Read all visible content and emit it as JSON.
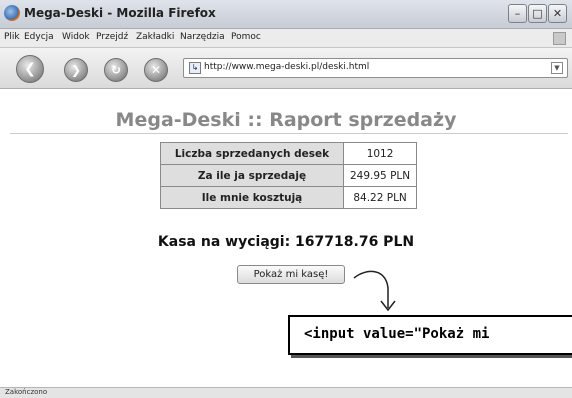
{
  "window": {
    "title": "Mega-Deski - Mozilla Firefox"
  },
  "menu": [
    "Plik",
    "Edycja",
    "Widok",
    "Przejdź",
    "Zakładki",
    "Narzędzia",
    "Pomoc"
  ],
  "url": "http://www.mega-deski.pl/deski.html",
  "page": {
    "title": "Mega-Deski :: Raport sprzedaży",
    "rows": [
      {
        "label": "Liczba sprzedanych desek",
        "value": "1012"
      },
      {
        "label": "Za ile ja sprzedaję",
        "value": "249.95 PLN"
      },
      {
        "label": "Ile mnie kosztują",
        "value": "84.22 PLN"
      }
    ],
    "kasa": "Kasa na wyciągi: 167718.76 PLN",
    "button_label": "Pokaż mi kasę!"
  },
  "annotation": {
    "code": "<input value=\"Pokaż mi"
  },
  "status": "Zakończono"
}
